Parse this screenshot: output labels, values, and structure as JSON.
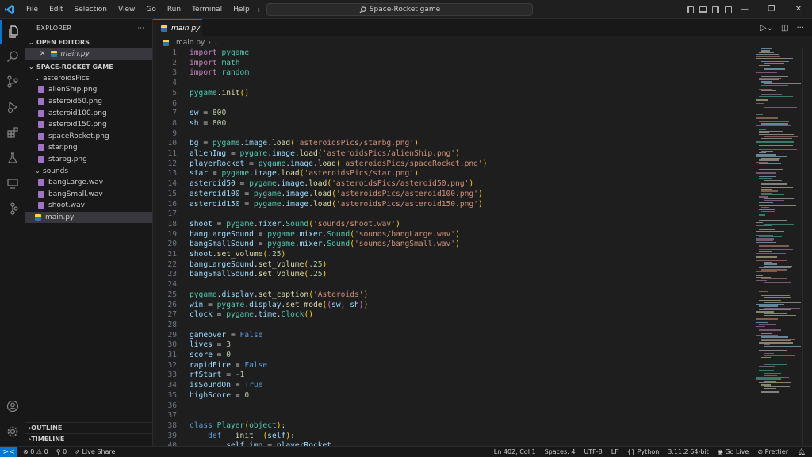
{
  "titlebar": {
    "menu": [
      "File",
      "Edit",
      "Selection",
      "View",
      "Go",
      "Run",
      "Terminal",
      "Help"
    ],
    "search_text": "Space-Rocket game"
  },
  "sidebar": {
    "title": "EXPLORER",
    "more": "···",
    "open_editors_label": "OPEN EDITORS",
    "open_editor_file": "main.py",
    "project_label": "SPACE-ROCKET GAME",
    "folders": [
      {
        "name": "asteroidsPics",
        "files": [
          "alienShip.png",
          "asteroid50.png",
          "asteroid100.png",
          "asteroid150.png",
          "spaceRocket.png",
          "star.png",
          "starbg.png"
        ]
      },
      {
        "name": "sounds",
        "files": [
          "bangLarge.wav",
          "bangSmall.wav",
          "shoot.wav"
        ]
      }
    ],
    "root_file": "main.py",
    "outline_label": "OUTLINE",
    "timeline_label": "TIMELINE"
  },
  "editor": {
    "tab_label": "main.py",
    "breadcrumb_file": "main.py",
    "breadcrumb_more": "...",
    "lines": [
      [
        [
          "kw",
          "import"
        ],
        [
          "t",
          " "
        ],
        [
          "mod",
          "pygame"
        ]
      ],
      [
        [
          "kw",
          "import"
        ],
        [
          "t",
          " "
        ],
        [
          "mod",
          "math"
        ]
      ],
      [
        [
          "kw",
          "import"
        ],
        [
          "t",
          " "
        ],
        [
          "mod",
          "random"
        ]
      ],
      [],
      [
        [
          "mod",
          "pygame"
        ],
        [
          "t",
          "."
        ],
        [
          "fn",
          "init"
        ],
        [
          "par",
          "()"
        ]
      ],
      [],
      [
        [
          "var",
          "sw"
        ],
        [
          "t",
          " = "
        ],
        [
          "num",
          "800"
        ]
      ],
      [
        [
          "var",
          "sh"
        ],
        [
          "t",
          " = "
        ],
        [
          "num",
          "800"
        ]
      ],
      [],
      [
        [
          "var",
          "bg"
        ],
        [
          "t",
          " = "
        ],
        [
          "mod",
          "pygame"
        ],
        [
          "t",
          "."
        ],
        [
          "var",
          "image"
        ],
        [
          "t",
          "."
        ],
        [
          "fn",
          "load"
        ],
        [
          "par",
          "("
        ],
        [
          "str",
          "'asteroidsPics/starbg.png'"
        ],
        [
          "par",
          ")"
        ]
      ],
      [
        [
          "var",
          "alienImg"
        ],
        [
          "t",
          " = "
        ],
        [
          "mod",
          "pygame"
        ],
        [
          "t",
          "."
        ],
        [
          "var",
          "image"
        ],
        [
          "t",
          "."
        ],
        [
          "fn",
          "load"
        ],
        [
          "par",
          "("
        ],
        [
          "str",
          "'asteroidsPics/alienShip.png'"
        ],
        [
          "par",
          ")"
        ]
      ],
      [
        [
          "var",
          "playerRocket"
        ],
        [
          "t",
          " = "
        ],
        [
          "mod",
          "pygame"
        ],
        [
          "t",
          "."
        ],
        [
          "var",
          "image"
        ],
        [
          "t",
          "."
        ],
        [
          "fn",
          "load"
        ],
        [
          "par",
          "("
        ],
        [
          "str",
          "'asteroidsPics/spaceRocket.png'"
        ],
        [
          "par",
          ")"
        ]
      ],
      [
        [
          "var",
          "star"
        ],
        [
          "t",
          " = "
        ],
        [
          "mod",
          "pygame"
        ],
        [
          "t",
          "."
        ],
        [
          "var",
          "image"
        ],
        [
          "t",
          "."
        ],
        [
          "fn",
          "load"
        ],
        [
          "par",
          "("
        ],
        [
          "str",
          "'asteroidsPics/star.png'"
        ],
        [
          "par",
          ")"
        ]
      ],
      [
        [
          "var",
          "asteroid50"
        ],
        [
          "t",
          " = "
        ],
        [
          "mod",
          "pygame"
        ],
        [
          "t",
          "."
        ],
        [
          "var",
          "image"
        ],
        [
          "t",
          "."
        ],
        [
          "fn",
          "load"
        ],
        [
          "par",
          "("
        ],
        [
          "str",
          "'asteroidsPics/asteroid50.png'"
        ],
        [
          "par",
          ")"
        ]
      ],
      [
        [
          "var",
          "asteroid100"
        ],
        [
          "t",
          " = "
        ],
        [
          "mod",
          "pygame"
        ],
        [
          "t",
          "."
        ],
        [
          "var",
          "image"
        ],
        [
          "t",
          "."
        ],
        [
          "fn",
          "load"
        ],
        [
          "par",
          "("
        ],
        [
          "str",
          "'asteroidsPics/asteroid100.png'"
        ],
        [
          "par",
          ")"
        ]
      ],
      [
        [
          "var",
          "asteroid150"
        ],
        [
          "t",
          " = "
        ],
        [
          "mod",
          "pygame"
        ],
        [
          "t",
          "."
        ],
        [
          "var",
          "image"
        ],
        [
          "t",
          "."
        ],
        [
          "fn",
          "load"
        ],
        [
          "par",
          "("
        ],
        [
          "str",
          "'asteroidsPics/asteroid150.png'"
        ],
        [
          "par",
          ")"
        ]
      ],
      [],
      [
        [
          "var",
          "shoot"
        ],
        [
          "t",
          " = "
        ],
        [
          "mod",
          "pygame"
        ],
        [
          "t",
          "."
        ],
        [
          "var",
          "mixer"
        ],
        [
          "t",
          "."
        ],
        [
          "mod",
          "Sound"
        ],
        [
          "par",
          "("
        ],
        [
          "str",
          "'sounds/shoot.wav'"
        ],
        [
          "par",
          ")"
        ]
      ],
      [
        [
          "var",
          "bangLargeSound"
        ],
        [
          "t",
          " = "
        ],
        [
          "mod",
          "pygame"
        ],
        [
          "t",
          "."
        ],
        [
          "var",
          "mixer"
        ],
        [
          "t",
          "."
        ],
        [
          "mod",
          "Sound"
        ],
        [
          "par",
          "("
        ],
        [
          "str",
          "'sounds/bangLarge.wav'"
        ],
        [
          "par",
          ")"
        ]
      ],
      [
        [
          "var",
          "bangSmallSound"
        ],
        [
          "t",
          " = "
        ],
        [
          "mod",
          "pygame"
        ],
        [
          "t",
          "."
        ],
        [
          "var",
          "mixer"
        ],
        [
          "t",
          "."
        ],
        [
          "mod",
          "Sound"
        ],
        [
          "par",
          "("
        ],
        [
          "str",
          "'sounds/bangSmall.wav'"
        ],
        [
          "par",
          ")"
        ]
      ],
      [
        [
          "var",
          "shoot"
        ],
        [
          "t",
          "."
        ],
        [
          "fn",
          "set_volume"
        ],
        [
          "par",
          "("
        ],
        [
          "num",
          ".25"
        ],
        [
          "par",
          ")"
        ]
      ],
      [
        [
          "var",
          "bangLargeSound"
        ],
        [
          "t",
          "."
        ],
        [
          "fn",
          "set_volume"
        ],
        [
          "par",
          "("
        ],
        [
          "num",
          ".25"
        ],
        [
          "par",
          ")"
        ]
      ],
      [
        [
          "var",
          "bangSmallSound"
        ],
        [
          "t",
          "."
        ],
        [
          "fn",
          "set_volume"
        ],
        [
          "par",
          "("
        ],
        [
          "num",
          ".25"
        ],
        [
          "par",
          ")"
        ]
      ],
      [],
      [
        [
          "mod",
          "pygame"
        ],
        [
          "t",
          "."
        ],
        [
          "var",
          "display"
        ],
        [
          "t",
          "."
        ],
        [
          "fn",
          "set_caption"
        ],
        [
          "par",
          "("
        ],
        [
          "str",
          "'Asteroids'"
        ],
        [
          "par",
          ")"
        ]
      ],
      [
        [
          "var",
          "win"
        ],
        [
          "t",
          " = "
        ],
        [
          "mod",
          "pygame"
        ],
        [
          "t",
          "."
        ],
        [
          "var",
          "display"
        ],
        [
          "t",
          "."
        ],
        [
          "fn",
          "set_mode"
        ],
        [
          "par",
          "("
        ],
        [
          "par2",
          "("
        ],
        [
          "var",
          "sw"
        ],
        [
          "t",
          ", "
        ],
        [
          "var",
          "sh"
        ],
        [
          "par2",
          ")"
        ],
        [
          "par",
          ")"
        ]
      ],
      [
        [
          "var",
          "clock"
        ],
        [
          "t",
          " = "
        ],
        [
          "mod",
          "pygame"
        ],
        [
          "t",
          "."
        ],
        [
          "var",
          "time"
        ],
        [
          "t",
          "."
        ],
        [
          "mod",
          "Clock"
        ],
        [
          "par",
          "()"
        ]
      ],
      [],
      [
        [
          "var",
          "gameover"
        ],
        [
          "t",
          " = "
        ],
        [
          "kw2",
          "False"
        ]
      ],
      [
        [
          "var",
          "lives"
        ],
        [
          "t",
          " = "
        ],
        [
          "num",
          "3"
        ]
      ],
      [
        [
          "var",
          "score"
        ],
        [
          "t",
          " = "
        ],
        [
          "num",
          "0"
        ]
      ],
      [
        [
          "var",
          "rapidFire"
        ],
        [
          "t",
          " = "
        ],
        [
          "kw2",
          "False"
        ]
      ],
      [
        [
          "var",
          "rfStart"
        ],
        [
          "t",
          " = "
        ],
        [
          "num",
          "-1"
        ]
      ],
      [
        [
          "var",
          "isSoundOn"
        ],
        [
          "t",
          " = "
        ],
        [
          "kw2",
          "True"
        ]
      ],
      [
        [
          "var",
          "highScore"
        ],
        [
          "t",
          " = "
        ],
        [
          "num",
          "0"
        ]
      ],
      [],
      [],
      [
        [
          "kw2",
          "class"
        ],
        [
          "t",
          " "
        ],
        [
          "mod",
          "Player"
        ],
        [
          "par",
          "("
        ],
        [
          "mod",
          "object"
        ],
        [
          "par",
          ")"
        ],
        [
          "t",
          ":"
        ]
      ],
      [
        [
          "t",
          "    "
        ],
        [
          "kw2",
          "def"
        ],
        [
          "t",
          " "
        ],
        [
          "fn",
          "__init__"
        ],
        [
          "par",
          "("
        ],
        [
          "var",
          "self"
        ],
        [
          "par",
          ")"
        ],
        [
          "t",
          ":"
        ]
      ],
      [
        [
          "t",
          "        "
        ],
        [
          "var",
          "self"
        ],
        [
          "t",
          "."
        ],
        [
          "var",
          "img"
        ],
        [
          "t",
          " = "
        ],
        [
          "var",
          "playerRocket"
        ]
      ]
    ]
  },
  "statusbar": {
    "remote_icon": "><",
    "problems": "⊗ 0 ⚠ 0",
    "ports": "⚲ 0",
    "live_share": "Live Share",
    "position": "Ln 402, Col 1",
    "spaces": "Spaces: 4",
    "encoding": "UTF-8",
    "eol": "LF",
    "language": "Python",
    "interpreter": "3.11.2 64-bit",
    "go_live": "Go Live",
    "prettier": "Prettier"
  },
  "colors": {
    "accent": "#0078d4",
    "editor_bg": "#1e1e1e",
    "sidebar_bg": "#181818",
    "keyword": "#c586c0",
    "string": "#ce9178",
    "type": "#4ec9b0",
    "function": "#dcdcaa",
    "variable": "#9cdcfe",
    "number": "#b5cea8"
  }
}
